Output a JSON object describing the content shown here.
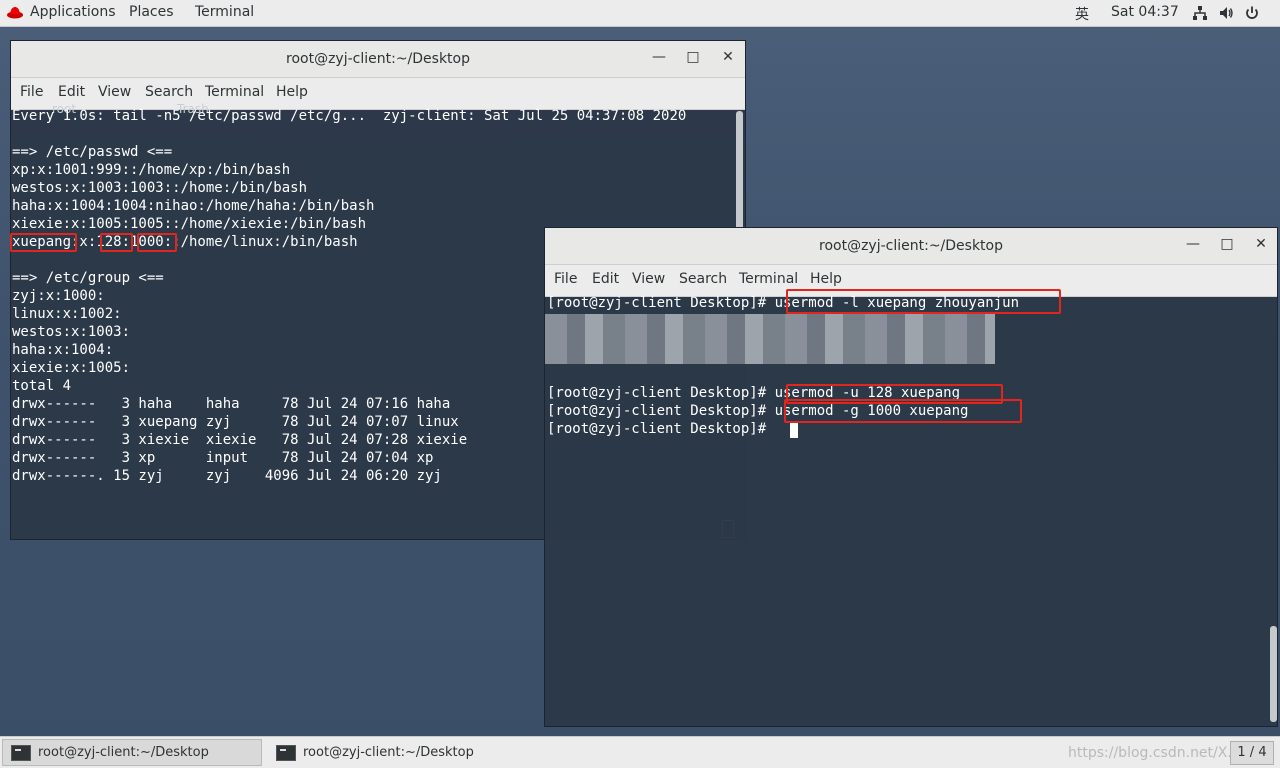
{
  "topbar": {
    "applications": "Applications",
    "places": "Places",
    "terminal": "Terminal",
    "ime": "英",
    "clock": "Sat 04:37"
  },
  "win1": {
    "title": "root@zyj-client:~/Desktop",
    "menu": [
      "File",
      "Edit",
      "View",
      "Search",
      "Terminal",
      "Help"
    ],
    "lines": [
      "Every 1.0s: tail -n5 /etc/passwd /etc/g...  zyj-client: Sat Jul 25 04:37:08 2020",
      "",
      "==> /etc/passwd <==",
      "xp:x:1001:999::/home/xp:/bin/bash",
      "westos:x:1003:1003::/home:/bin/bash",
      "haha:x:1004:1004:nihao:/home/haha:/bin/bash",
      "xiexie:x:1005:1005::/home/xiexie:/bin/bash",
      "xuepang:x:128:1000::/home/linux:/bin/bash",
      "",
      "==> /etc/group <==",
      "zyj:x:1000:",
      "linux:x:1002:",
      "westos:x:1003:",
      "haha:x:1004:",
      "xiexie:x:1005:",
      "total 4",
      "drwx------   3 haha    haha     78 Jul 24 07:16 haha",
      "drwx------   3 xuepang zyj      78 Jul 24 07:07 linux",
      "drwx------   3 xiexie  xiexie   78 Jul 24 07:28 xiexie",
      "drwx------   3 xp      input    78 Jul 24 07:04 xp",
      "drwx------. 15 zyj     zyj    4096 Jul 24 06:20 zyj"
    ],
    "ghost1": "root",
    "ghost2": "Trash"
  },
  "win2": {
    "title": "root@zyj-client:~/Desktop",
    "menu": [
      "File",
      "Edit",
      "View",
      "Search",
      "Terminal",
      "Help"
    ],
    "lines": [
      "[root@zyj-client Desktop]# usermod -l xuepang zhouyanjun",
      "",
      "",
      "",
      "",
      "[root@zyj-client Desktop]# usermod -u 128 xuepang",
      "[root@zyj-client Desktop]# usermod -g 1000 xuepang",
      "[root@zyj-client Desktop]# "
    ]
  },
  "taskbar": {
    "task1": "root@zyj-client:~/Desktop",
    "task2": "root@zyj-client:~/Desktop",
    "watermark": "https://blog.csdn.net/X...",
    "pager": "1 / 4"
  },
  "colors": {
    "highlight": "#e2261e",
    "terminal_bg": "#2c3848",
    "bar_bg": "#ececec"
  }
}
